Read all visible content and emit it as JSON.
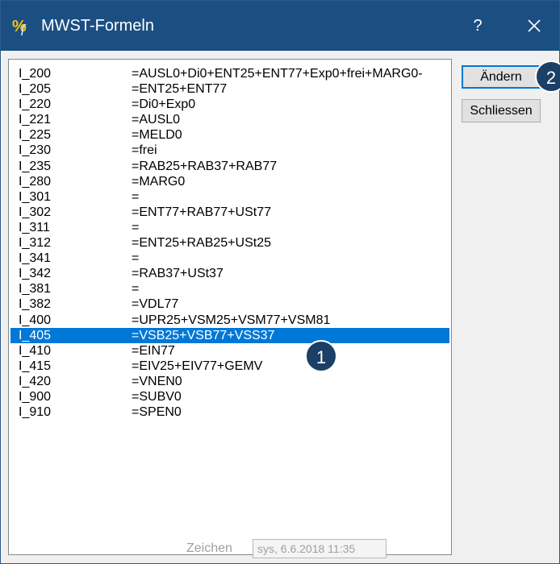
{
  "window": {
    "title": "MWST-Formeln",
    "help_label": "?",
    "icon": "percent-formula-icon",
    "colors": {
      "titlebar": "#1b4f82",
      "selection": "#0078d7",
      "callout": "#1c3f66"
    }
  },
  "list": {
    "items": [
      {
        "name": "I_200",
        "formula": "=AUSL0+Di0+ENT25+ENT77+Exp0+frei+MARG0-"
      },
      {
        "name": "I_205",
        "formula": "=ENT25+ENT77"
      },
      {
        "name": "I_220",
        "formula": "=Di0+Exp0"
      },
      {
        "name": "I_221",
        "formula": "=AUSL0"
      },
      {
        "name": "I_225",
        "formula": "=MELD0"
      },
      {
        "name": "I_230",
        "formula": "=frei"
      },
      {
        "name": "I_235",
        "formula": "=RAB25+RAB37+RAB77"
      },
      {
        "name": "I_280",
        "formula": "=MARG0"
      },
      {
        "name": "I_301",
        "formula": "="
      },
      {
        "name": "I_302",
        "formula": "=ENT77+RAB77+USt77"
      },
      {
        "name": "I_311",
        "formula": "="
      },
      {
        "name": "I_312",
        "formula": "=ENT25+RAB25+USt25"
      },
      {
        "name": "I_341",
        "formula": "="
      },
      {
        "name": "I_342",
        "formula": "=RAB37+USt37"
      },
      {
        "name": "I_381",
        "formula": "="
      },
      {
        "name": "I_382",
        "formula": "=VDL77"
      },
      {
        "name": "I_400",
        "formula": "=UPR25+VSM25+VSM77+VSM81"
      },
      {
        "name": "I_405",
        "formula": "=VSB25+VSB77+VSS37",
        "selected": true
      },
      {
        "name": "I_410",
        "formula": "=EIN77"
      },
      {
        "name": "I_415",
        "formula": "=EIV25+EIV77+GEMV"
      },
      {
        "name": "I_420",
        "formula": "=VNEN0"
      },
      {
        "name": "I_900",
        "formula": "=SUBV0"
      },
      {
        "name": "I_910",
        "formula": "=SPEN0"
      }
    ]
  },
  "buttons": {
    "aendern": "Ändern",
    "schliessen": "Schliessen"
  },
  "callouts": {
    "one": "1",
    "two": "2"
  },
  "zeichen": {
    "label": "Zeichen",
    "value": "sys,  6.6.2018  11:35"
  }
}
